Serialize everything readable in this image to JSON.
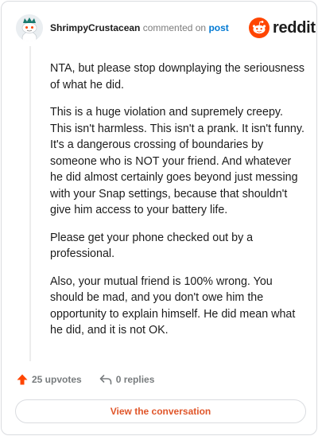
{
  "comment": {
    "username": "ShrimpyCrustacean",
    "commented_on": "commented on",
    "post_link": "post",
    "paragraphs": [
      "NTA, but please stop downplaying the seriousness of what he did.",
      "This is a huge violation and supremely creepy. This isn't harmless. This isn't a prank. It isn't funny. It's a dangerous crossing of boundaries by someone who is NOT your friend. And whatever he did almost certainly goes beyond just messing with your Snap settings, because that shouldn't give him access to your battery life.",
      "Please get your phone checked out by a professional.",
      "Also, your mutual friend is 100% wrong. You should be mad, and you don't owe him the opportunity to explain himself. He did mean what he did, and it is not OK."
    ]
  },
  "brand": {
    "wordmark": "reddit",
    "accent_color": "#ff4500"
  },
  "actions": {
    "upvotes": "25 upvotes",
    "replies": "0 replies"
  },
  "footer": {
    "view_label": "View the conversation"
  },
  "icons": {
    "avatar": "snoo-avatar",
    "logo": "reddit-alien-icon",
    "upvote": "upvote-arrow-icon",
    "reply": "reply-arrow-icon"
  }
}
